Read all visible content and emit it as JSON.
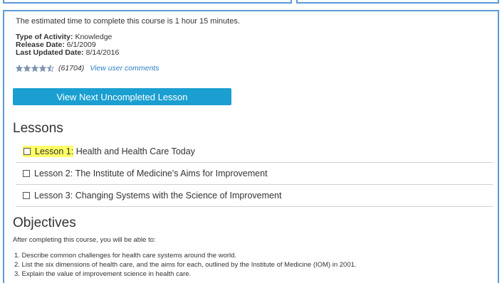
{
  "course": {
    "estimated_time": "The estimated time to complete this course is 1 hour 15 minutes.",
    "activity_label": "Type of Activity:",
    "activity_value": "Knowledge",
    "release_label": "Release Date:",
    "release_value": "6/1/2009",
    "updated_label": "Last Updated Date:",
    "updated_value": "8/14/2016",
    "rating_stars": 4.5,
    "rating_count": "(61704)",
    "comments_link": "View user comments",
    "next_lesson_button": "View Next Uncompleted Lesson"
  },
  "lessons": {
    "heading": "Lessons",
    "items": [
      {
        "prefix": "Lesson 1:",
        "title": "Health and Health Care Today",
        "highlighted": true
      },
      {
        "prefix": "Lesson 2:",
        "title": "The Institute of Medicine's Aims for Improvement",
        "highlighted": false
      },
      {
        "prefix": "Lesson 3:",
        "title": "Changing Systems with the Science of Improvement",
        "highlighted": false
      }
    ]
  },
  "objectives": {
    "heading": "Objectives",
    "intro": "After completing this course, you will be able to:",
    "items": [
      "1. Describe common challenges for health care systems around the world.",
      "2. List the six dimensions of health care, and the aims for each, outlined by the Institute of Medicine (IOM) in 2001.",
      "3. Explain the value of improvement science in health care."
    ]
  },
  "colors": {
    "accent": "#1a9fd0",
    "border": "#5b9bd5",
    "highlight": "#ffff66",
    "link": "#2a80c4"
  }
}
